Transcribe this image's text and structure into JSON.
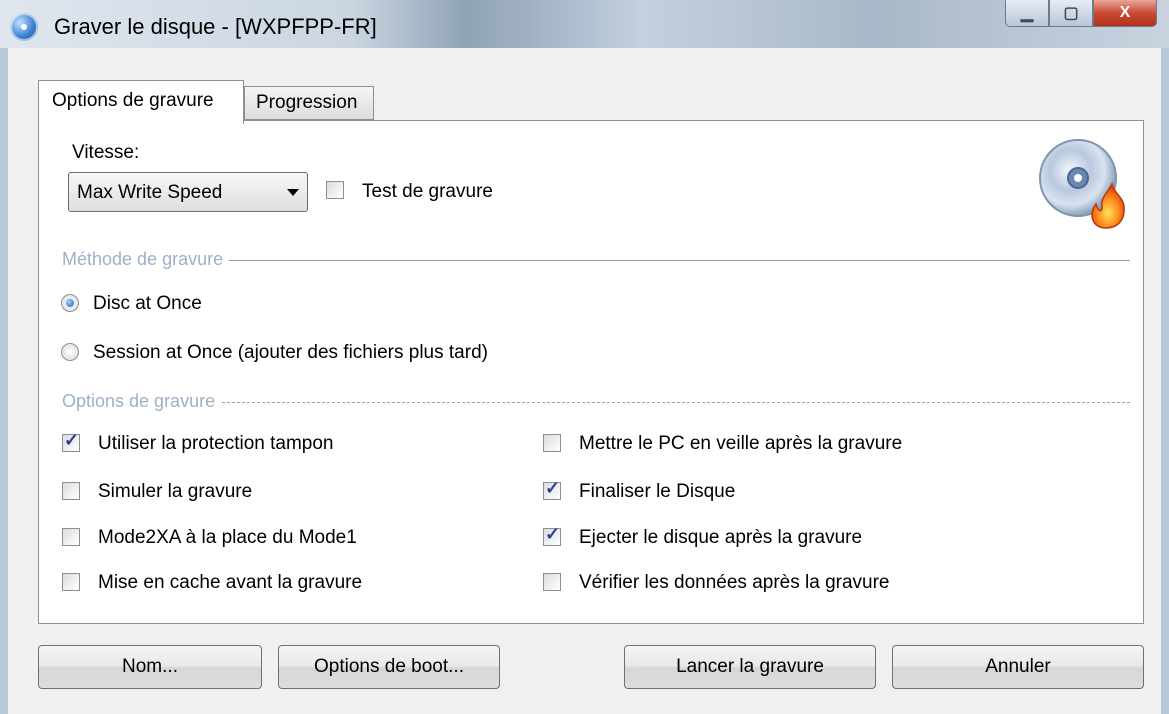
{
  "window": {
    "title": "Graver le disque - [WXPFPP-FR]",
    "controls": [
      "minimize-icon",
      "maximize-icon",
      "close-icon"
    ],
    "close_glyph": "X"
  },
  "tabs": [
    {
      "label": "Options de gravure",
      "active": true
    },
    {
      "label": "Progression",
      "active": false
    }
  ],
  "speed": {
    "label": "Vitesse:",
    "selected": "Max Write Speed",
    "test_label": "Test de gravure",
    "test_checked": false
  },
  "method": {
    "title": "Méthode de gravure",
    "options": [
      {
        "label": "Disc at Once",
        "selected": true
      },
      {
        "label": "Session at Once (ajouter des fichiers plus tard)",
        "selected": false
      }
    ]
  },
  "options": {
    "title": "Options de gravure",
    "left": [
      {
        "label": "Utiliser la protection tampon",
        "checked": true
      },
      {
        "label": "Simuler la gravure",
        "checked": false
      },
      {
        "label": "Mode2XA à la place du Mode1",
        "checked": false
      },
      {
        "label": "Mise en cache avant la gravure",
        "checked": false
      }
    ],
    "right": [
      {
        "label": "Mettre le PC en veille après la gravure",
        "checked": false
      },
      {
        "label": "Finaliser le Disque",
        "checked": true
      },
      {
        "label": "Ejecter le disque après la gravure",
        "checked": true
      },
      {
        "label": "Vérifier les données après la gravure",
        "checked": false
      }
    ]
  },
  "buttons": {
    "name": "Nom...",
    "boot": "Options de boot...",
    "burn": "Lancer la gravure",
    "cancel": "Annuler"
  },
  "icons": {
    "app": "burn-app-icon",
    "disc": "disc-burn-icon"
  },
  "colors": {
    "group_title": "#9fb0c6",
    "check": "#2b3f9a",
    "radio": "#1f5fb6",
    "close": "#c84a33"
  }
}
